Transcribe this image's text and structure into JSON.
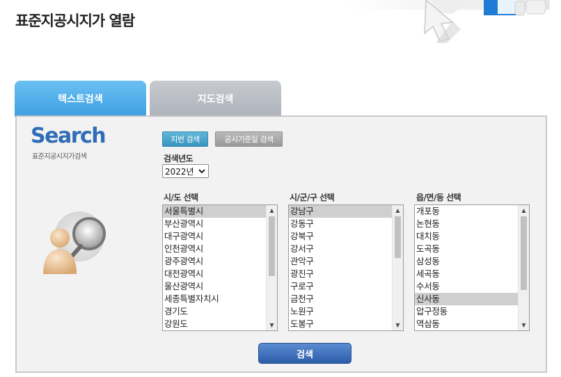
{
  "header": {
    "title": "표준지공시지가 열람"
  },
  "tabs": [
    {
      "label": "텍스트검색",
      "active": true
    },
    {
      "label": "지도검색",
      "active": false
    }
  ],
  "logo": {
    "title": "Search",
    "subtitle": "표준지공시지가검색"
  },
  "buttons": {
    "jibun": "지번 검색",
    "date": "공시기준일 검색",
    "search": "검색"
  },
  "year": {
    "label": "검색년도",
    "value": "2022년"
  },
  "lists": {
    "sido": {
      "label": "시/도 선택",
      "items": [
        "서울특별시",
        "부산광역시",
        "대구광역시",
        "인천광역시",
        "광주광역시",
        "대전광역시",
        "울산광역시",
        "세종특별자치시",
        "경기도",
        "강원도"
      ],
      "selected": "서울특별시"
    },
    "sigungu": {
      "label": "시/군/구 선택",
      "items": [
        "강남구",
        "강동구",
        "강북구",
        "강서구",
        "관악구",
        "광진구",
        "구로구",
        "금천구",
        "노원구",
        "도봉구"
      ],
      "selected": "강남구"
    },
    "eupmyeondong": {
      "label": "읍/면/동 선택",
      "items": [
        "개포동",
        "논현동",
        "대치동",
        "도곡동",
        "삼성동",
        "세곡동",
        "수서동",
        "신사동",
        "압구정동",
        "역삼동"
      ],
      "selected": "신사동"
    }
  },
  "colors": {
    "tab_active": "#4aa9ea",
    "tab_inactive": "#b9bcc3",
    "search_button": "#2d5da8",
    "logo": "#2f6db8"
  }
}
